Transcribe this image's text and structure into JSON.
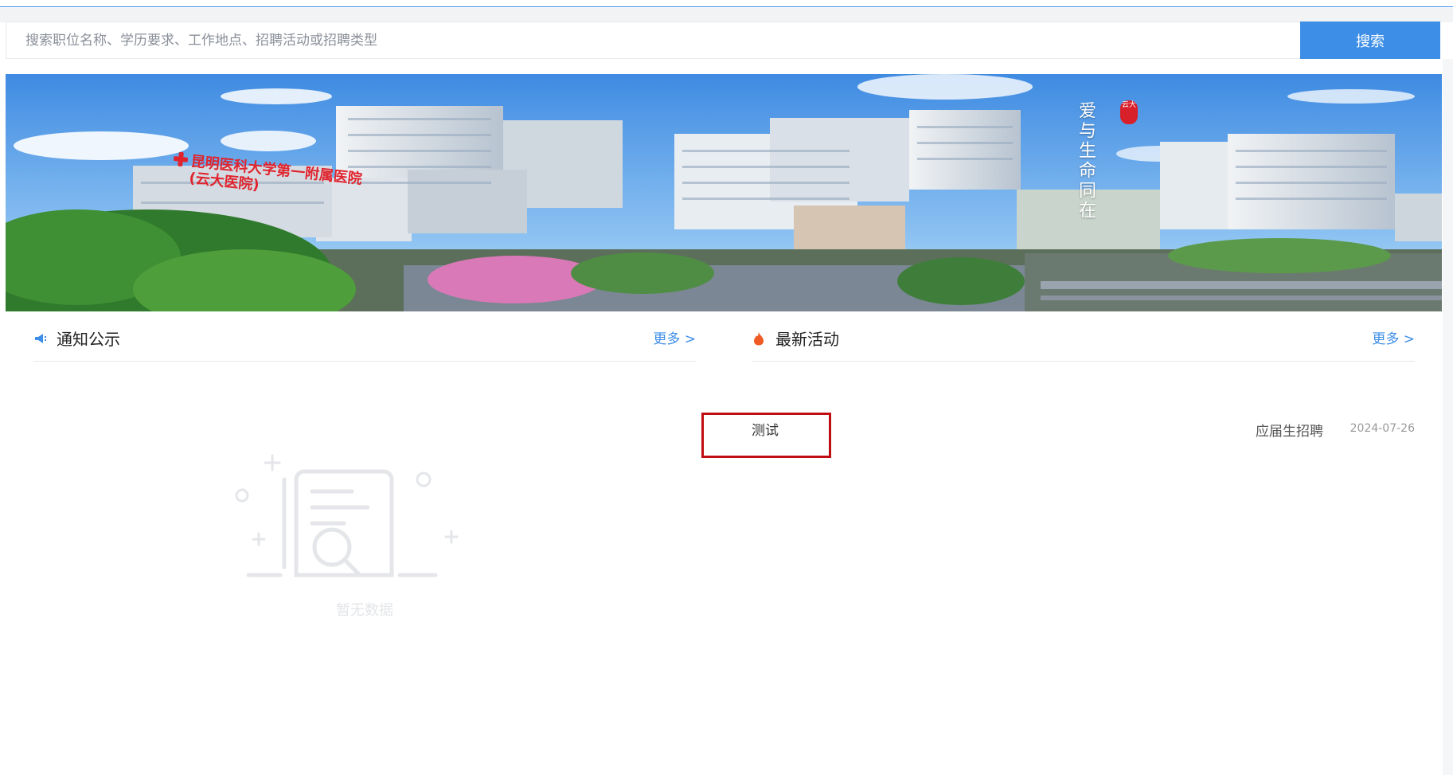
{
  "search": {
    "placeholder": "搜索职位名称、学历要求、工作地点、招聘活动或招聘类型",
    "button_label": "搜索"
  },
  "banner": {
    "hospital_sign_line1": "昆明医科大学第一附属医院",
    "hospital_sign_line2": "(云大医院)",
    "slogan": "爱与生命同在",
    "seal_text": "云大"
  },
  "notices": {
    "title": "通知公示",
    "icon": "megaphone-icon",
    "more_label": "更多 >",
    "empty_text": "暂无数据"
  },
  "activities": {
    "title": "最新活动",
    "icon": "flame-icon",
    "more_label": "更多 >",
    "items": [
      {
        "name": "测试",
        "type": "应届生招聘",
        "date": "2024-07-26"
      }
    ]
  },
  "colors": {
    "accent": "#3d8ee6",
    "highlight": "#c00d12",
    "flame": "#f05a24"
  }
}
